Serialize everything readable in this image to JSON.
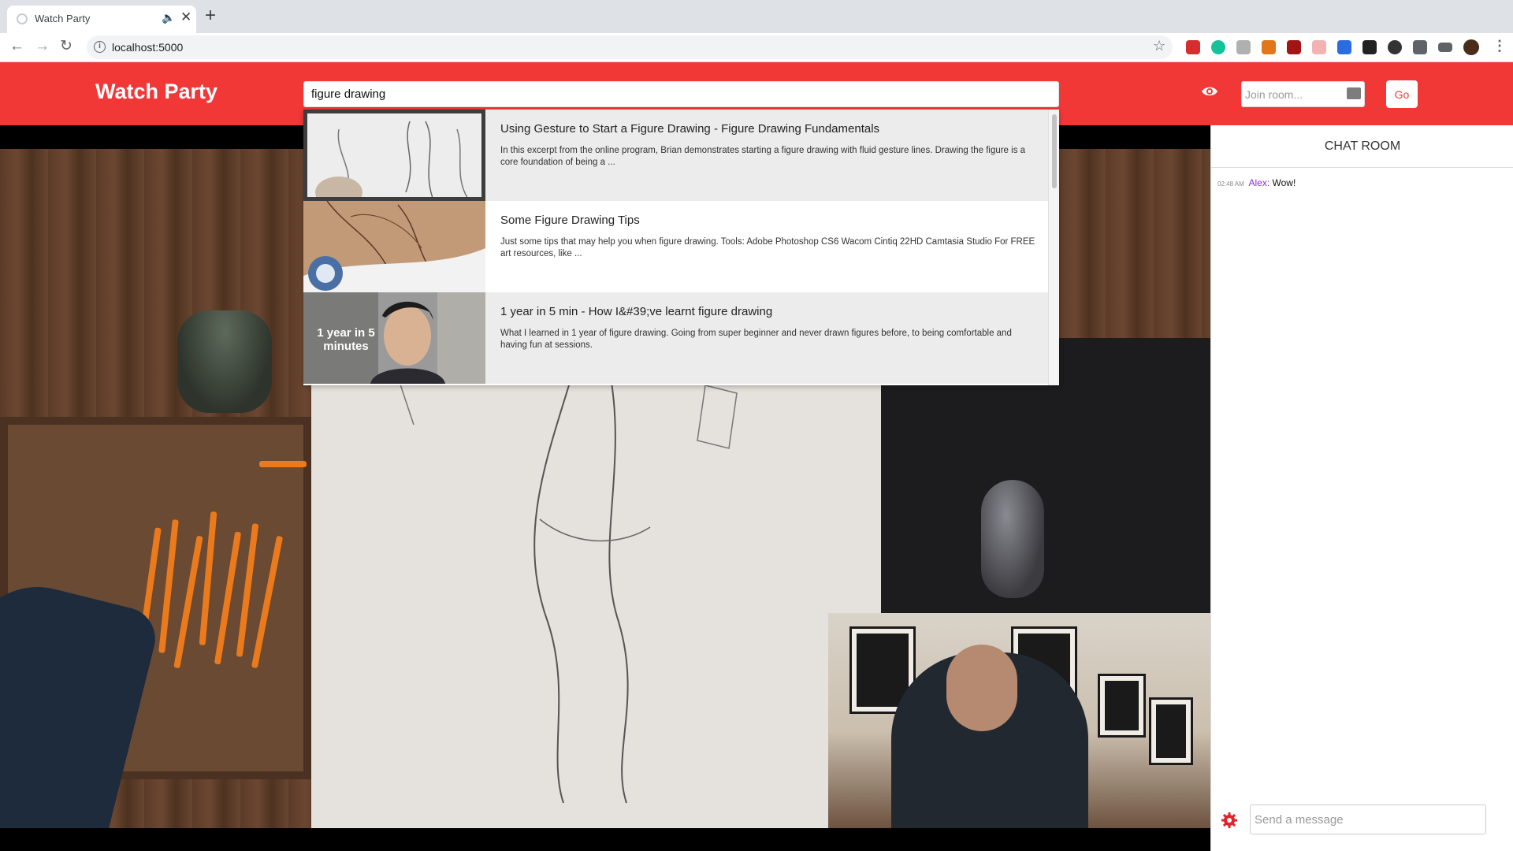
{
  "browser": {
    "tab_title": "Watch Party",
    "url": "localhost:5000",
    "icons": [
      "back-icon",
      "forward-icon",
      "reload-icon",
      "info-icon",
      "bookmark-star-icon",
      "extensions-icon",
      "menu-icon"
    ]
  },
  "header": {
    "brand": "Watch Party",
    "search_value": "figure drawing",
    "join_placeholder": "Join room...",
    "go_label": "Go",
    "accent_color": "#f23737"
  },
  "results": [
    {
      "title": "Using Gesture to Start a Figure Drawing - Figure Drawing Fundamentals",
      "description": "In this excerpt from the online program, Brian demonstrates starting a figure drawing with fluid gesture lines. Drawing the figure is a core foundation of being a ..."
    },
    {
      "title": "Some Figure Drawing Tips",
      "description": "Just some tips that may help you when figure drawing. Tools: Adobe Photoshop CS6 Wacom Cintiq 22HD Camtasia Studio For FREE art resources, like ..."
    },
    {
      "title": "1 year in 5 min - How I&#39;ve learnt figure drawing",
      "description": "What I learned in 1 year of figure drawing. Going from super beginner and never drawn figures before, to being comfortable and having fun at sessions.",
      "thumb_caption": "1 year in 5 minutes"
    }
  ],
  "chat": {
    "title": "CHAT ROOM",
    "messages": [
      {
        "time": "02:48 AM",
        "user": "Alex:",
        "text": "Wow!"
      }
    ],
    "input_placeholder": "Send a message"
  }
}
